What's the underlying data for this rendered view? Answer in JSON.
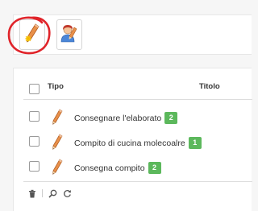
{
  "toolbar": {
    "buttons": [
      {
        "icon": "pencil-icon"
      },
      {
        "icon": "user-edit-icon"
      }
    ]
  },
  "table": {
    "columns": [
      "Tipo",
      "Titolo"
    ],
    "rows": [
      {
        "title": "Consegnare l'elaborato",
        "count": "2"
      },
      {
        "title": "Compito di cucina molecoalre",
        "count": "1"
      },
      {
        "title": "Consegna compito",
        "count": "2"
      }
    ]
  },
  "footer": {
    "icons": [
      "trash-icon",
      "search-icon",
      "refresh-icon"
    ]
  },
  "colors": {
    "badge": "#5cb85c",
    "annotation": "#e0242a"
  }
}
